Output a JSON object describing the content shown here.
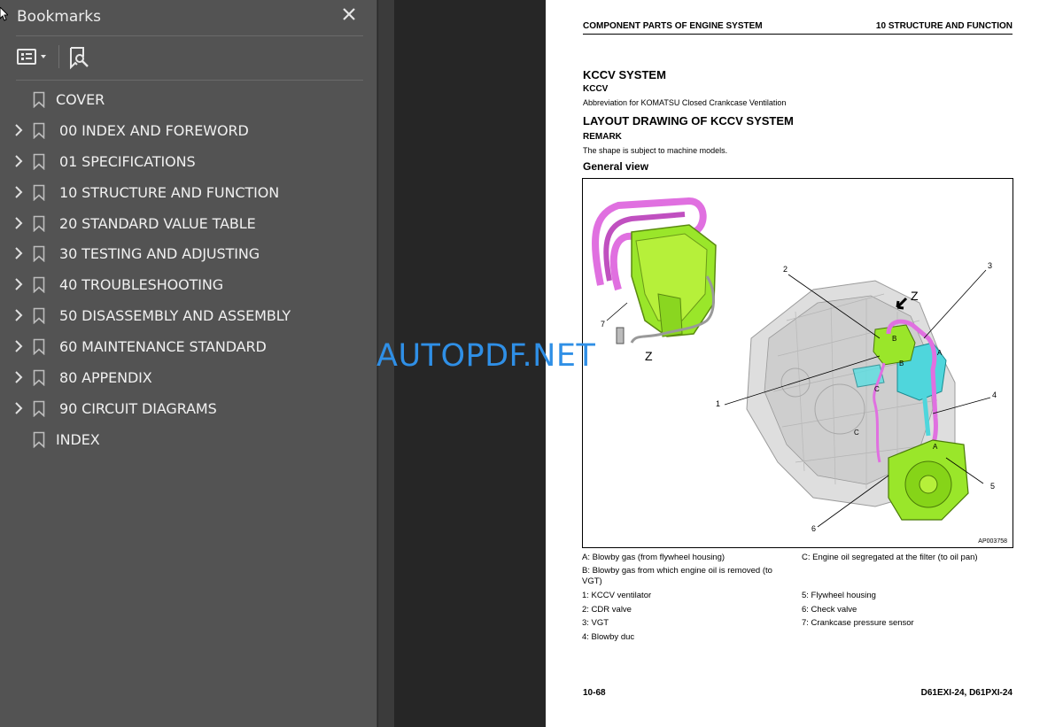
{
  "sidebar": {
    "title": "Bookmarks",
    "close_icon": "close-icon",
    "toolbar": {
      "options_icon": "list-options-icon",
      "find_icon": "bookmark-search-icon"
    },
    "items": [
      {
        "label": "COVER",
        "expandable": false
      },
      {
        "label": "00 INDEX AND FOREWORD",
        "expandable": true
      },
      {
        "label": "01 SPECIFICATIONS",
        "expandable": true
      },
      {
        "label": "10 STRUCTURE AND FUNCTION",
        "expandable": true
      },
      {
        "label": "20 STANDARD VALUE TABLE",
        "expandable": true
      },
      {
        "label": "30 TESTING AND ADJUSTING",
        "expandable": true
      },
      {
        "label": "40 TROUBLESHOOTING",
        "expandable": true
      },
      {
        "label": "50 DISASSEMBLY AND ASSEMBLY",
        "expandable": true
      },
      {
        "label": "60 MAINTENANCE STANDARD",
        "expandable": true
      },
      {
        "label": "80 APPENDIX",
        "expandable": true
      },
      {
        "label": "90 CIRCUIT DIAGRAMS",
        "expandable": true
      },
      {
        "label": "INDEX",
        "expandable": false
      }
    ]
  },
  "watermark": "AUTOPDF.NET",
  "page": {
    "header_left": "COMPONENT PARTS OF ENGINE SYSTEM",
    "header_right": "10 STRUCTURE AND FUNCTION",
    "heading1": "KCCV SYSTEM",
    "heading2": "KCCV",
    "para1": "Abbreviation for KOMATSU Closed Crankcase Ventilation",
    "heading3": "LAYOUT DRAWING OF KCCV SYSTEM",
    "heading4": "REMARK",
    "para2": "The shape is subject to machine models.",
    "heading5": "General view",
    "figure": {
      "code": "AP003758",
      "labels": {
        "n1": "1",
        "n2": "2",
        "n3": "3",
        "n4": "4",
        "n5": "5",
        "n6": "6",
        "n7": "7",
        "z1": "Z",
        "z2": "Z",
        "a1": "A",
        "a2": "A",
        "b1": "B",
        "b2": "B",
        "c1": "C",
        "c2": "C"
      }
    },
    "legend": {
      "a": "A: Blowby gas (from flywheel housing)",
      "c": "C: Engine oil segregated at the filter (to oil pan)",
      "b": "B:  Blowby gas from which engine oil is removed (to VGT)",
      "i1": "1: KCCV ventilator",
      "i2": "2: CDR valve",
      "i3": "3: VGT",
      "i4": "4: Blowby duc",
      "i5": "5: Flywheel housing",
      "i6": "6: Check valve",
      "i7": "7: Crankcase pressure sensor"
    },
    "footer_left": "10-68",
    "footer_right": "D61EXI-24, D61PXI-24"
  }
}
